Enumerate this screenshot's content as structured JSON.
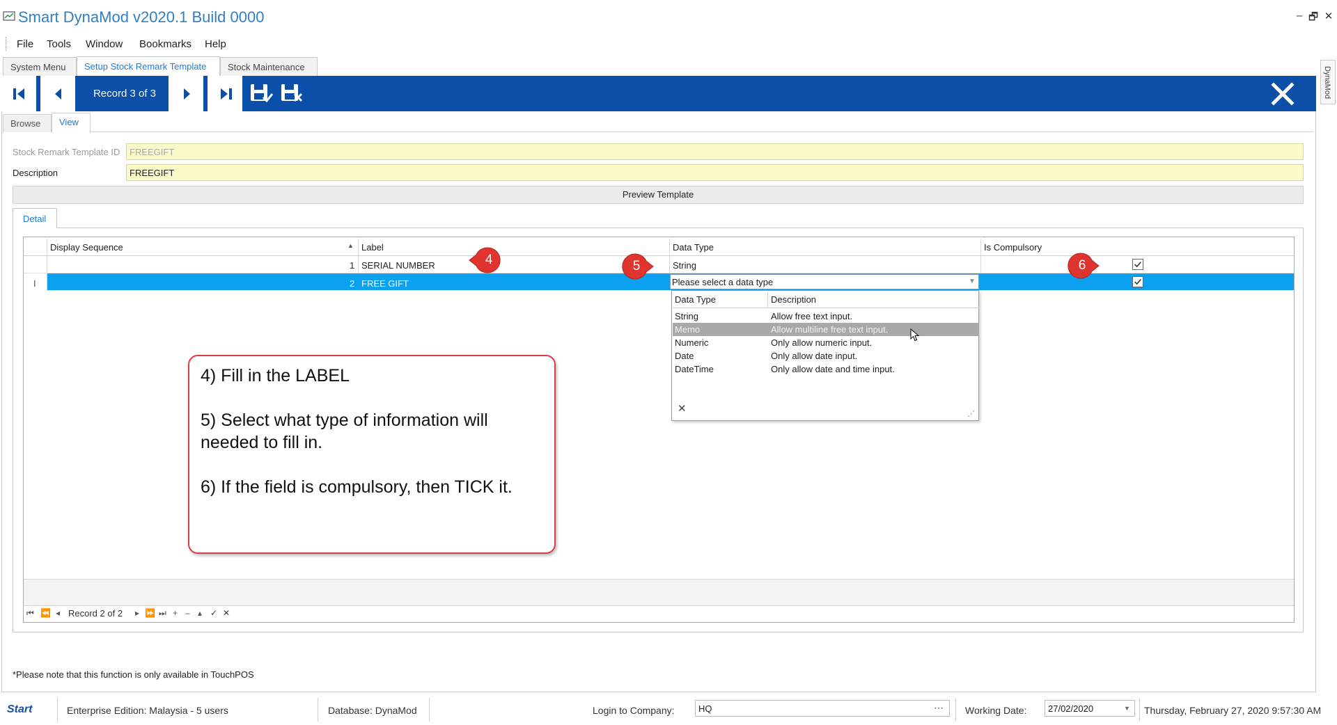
{
  "app": {
    "title": "Smart DynaMod v2020.1 Build 0000"
  },
  "menu": [
    "File",
    "Tools",
    "Window",
    "Bookmarks",
    "Help"
  ],
  "tabs": [
    "System Menu",
    "Setup Stock Remark Template",
    "Stock Maintenance"
  ],
  "side_tab": "DynaMod",
  "toolbar": {
    "record": "Record 3 of 3"
  },
  "subtabs": [
    "Browse",
    "View"
  ],
  "form": {
    "id_label": "Stock Remark Template ID",
    "id_value": "FREEGIFT",
    "desc_label": "Description",
    "desc_value": "FREEGIFT",
    "preview_button": "Preview Template"
  },
  "detail": {
    "tab": "Detail",
    "columns": [
      "Display Sequence",
      "Label",
      "Data Type",
      "Is Compulsory"
    ],
    "rows": [
      {
        "seq": "1",
        "label": "SERIAL NUMBER",
        "data_type": "String",
        "compulsory": true
      },
      {
        "seq": "2",
        "label": "FREE GIFT",
        "data_type": "Please select a data type",
        "compulsory": true
      }
    ],
    "row_indicator": "I",
    "dropdown": {
      "columns": [
        "Data Type",
        "Description"
      ],
      "items": [
        {
          "type": "String",
          "desc": "Allow free text input."
        },
        {
          "type": "Memo",
          "desc": "Allow multiline free text input."
        },
        {
          "type": "Numeric",
          "desc": "Only allow numeric input."
        },
        {
          "type": "Date",
          "desc": "Only allow date input."
        },
        {
          "type": "DateTime",
          "desc": "Only allow date and time input."
        }
      ],
      "highlighted_index": 1,
      "close": "✕"
    },
    "navigator": {
      "record": "Record 2 of 2"
    }
  },
  "annotations": {
    "callouts": [
      "4",
      "5",
      "6"
    ],
    "note_lines": [
      "4) Fill in the LABEL",
      "5) Select what type of information will needed to fill in.",
      "6) If the field is compulsory, then TICK it."
    ]
  },
  "footnote": "*Please note that this function is only available in TouchPOS",
  "status": {
    "logo": "Start",
    "edition": "Enterprise Edition: Malaysia - 5 users",
    "database": "Database: DynaMod",
    "login_label": "Login to Company:",
    "company": "HQ",
    "working_date_label": "Working Date:",
    "working_date": "27/02/2020",
    "datetime": "Thursday, February 27, 2020 9:57:30 AM"
  },
  "colors": {
    "toolbar_blue": "#0b4fa8",
    "selection": "#0ba0f0",
    "field_yellow": "#fbfbc9",
    "callout_red": "#e0342f",
    "title_blue": "#2f7fc4"
  }
}
